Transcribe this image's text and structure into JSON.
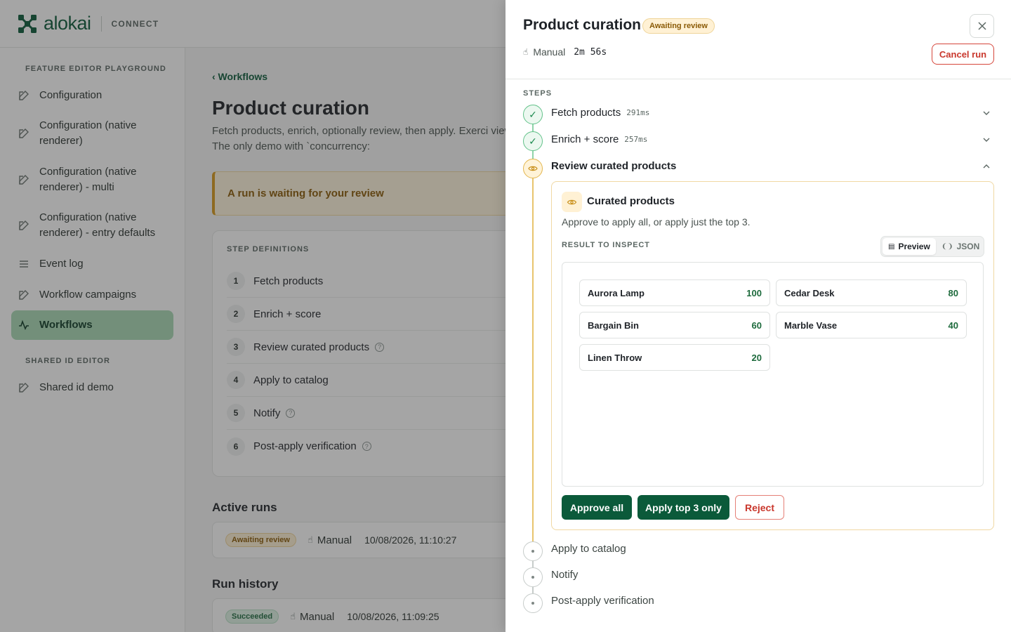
{
  "app": {
    "logo_text": "alokai",
    "logo_sub": "CONNECT"
  },
  "sidebar": {
    "sections": [
      {
        "title": "FEATURE EDITOR PLAYGROUND",
        "items": [
          {
            "label": "Configuration",
            "icon": "edit-icon"
          },
          {
            "label": "Configuration (native renderer)",
            "icon": "edit-icon"
          },
          {
            "label": "Configuration (native renderer) - multi",
            "icon": "edit-icon"
          },
          {
            "label": "Configuration (native renderer) - entry defaults",
            "icon": "edit-icon"
          },
          {
            "label": "Event log",
            "icon": "list-icon"
          },
          {
            "label": "Workflow campaigns",
            "icon": "edit-icon"
          },
          {
            "label": "Workflows",
            "icon": "activity-icon",
            "active": true
          }
        ]
      },
      {
        "title": "SHARED ID EDITOR",
        "items": [
          {
            "label": "Shared id demo",
            "icon": "edit-icon"
          }
        ]
      }
    ]
  },
  "main": {
    "back_link": "‹ Workflows",
    "title": "Product curation",
    "description": "Fetch products, enrich, optionally review, then apply. Exerci view, and a failure path. The only demo with `concurrency:",
    "banner": "A run is waiting for your review",
    "step_definitions": {
      "heading": "STEP DEFINITIONS",
      "steps": [
        {
          "num": "1",
          "label": "Fetch products",
          "help": false
        },
        {
          "num": "2",
          "label": "Enrich + score",
          "help": false
        },
        {
          "num": "3",
          "label": "Review curated products",
          "help": true
        },
        {
          "num": "4",
          "label": "Apply to catalog",
          "help": false
        },
        {
          "num": "5",
          "label": "Notify",
          "help": true
        },
        {
          "num": "6",
          "label": "Post-apply verification",
          "help": true
        }
      ]
    },
    "active_runs": {
      "title": "Active runs",
      "rows": [
        {
          "status": "Awaiting review",
          "trigger": "Manual",
          "time": "10/08/2026, 11:10:27"
        }
      ]
    },
    "run_history": {
      "title": "Run history",
      "rows": [
        {
          "status": "Succeeded",
          "trigger": "Manual",
          "time": "10/08/2026, 11:09:25"
        }
      ]
    }
  },
  "drawer": {
    "title": "Product curation",
    "status": "Awaiting review",
    "trigger": "Manual",
    "duration": "2m 56s",
    "cancel_label": "Cancel run",
    "close_icon": "close-icon",
    "steps_heading": "STEPS",
    "steps": [
      {
        "label": "Fetch products",
        "duration": "291ms",
        "state": "done"
      },
      {
        "label": "Enrich + score",
        "duration": "257ms",
        "state": "done"
      },
      {
        "label": "Review curated products",
        "duration": "",
        "state": "waiting"
      },
      {
        "label": "Apply to catalog",
        "duration": "",
        "state": "pending"
      },
      {
        "label": "Notify",
        "duration": "",
        "state": "pending"
      },
      {
        "label": "Post-apply verification",
        "duration": "",
        "state": "pending"
      }
    ],
    "review": {
      "title": "Curated products",
      "description": "Approve to apply all, or apply just the top 3.",
      "result_heading": "RESULT TO INSPECT",
      "view_tabs": [
        {
          "label": "Preview",
          "active": true
        },
        {
          "label": "JSON",
          "active": false
        }
      ],
      "products": [
        {
          "name": "Aurora Lamp",
          "score": "100"
        },
        {
          "name": "Cedar Desk",
          "score": "80"
        },
        {
          "name": "Bargain Bin",
          "score": "60"
        },
        {
          "name": "Marble Vase",
          "score": "40"
        },
        {
          "name": "Linen Throw",
          "score": "20"
        }
      ],
      "actions": {
        "approve_all": "Approve all",
        "apply_top": "Apply top 3 only",
        "reject": "Reject"
      }
    }
  },
  "colors": {
    "brand": "#0b5a3a",
    "warning": "#d89a1c",
    "success": "#63c28a",
    "danger": "#c9372c"
  }
}
